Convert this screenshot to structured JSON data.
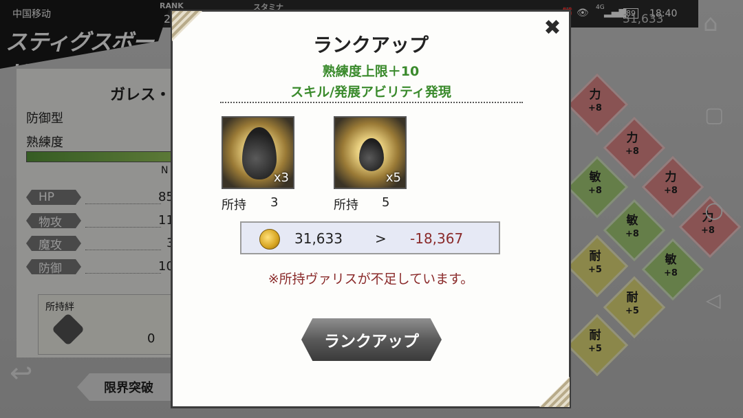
{
  "status_bar": {
    "carrier": "中国移动",
    "network": "4G",
    "battery": "89",
    "time": "18:40"
  },
  "background": {
    "rank_label": "RANK",
    "rank_value": "2",
    "stamina_label": "スタミナ",
    "gold": "31,633",
    "character_name": "ガレス・",
    "type": "防御型",
    "proficiency_label": "熟練度",
    "proficiency_tail": "N",
    "stats": [
      {
        "label": "HP",
        "value": "85",
        "icon": "heart-icon"
      },
      {
        "label": "物攻",
        "value": "11",
        "icon": "sword-icon"
      },
      {
        "label": "魔攻",
        "value": "3",
        "icon": "staff-icon"
      },
      {
        "label": "防御",
        "value": "10",
        "icon": "shield-icon"
      }
    ],
    "bond_label": "所持絆",
    "bond_value": "0",
    "limit_break": "限界突破",
    "board_tiles": [
      {
        "stat": "力",
        "bonus": "+8",
        "color": "#e58a8a"
      },
      {
        "stat": "力",
        "bonus": "+8",
        "color": "#e58a8a"
      },
      {
        "stat": "力",
        "bonus": "+8",
        "color": "#e58a8a"
      },
      {
        "stat": "力",
        "bonus": "+8",
        "color": "#e58a8a"
      },
      {
        "stat": "敏",
        "bonus": "+8",
        "color": "#a9d27a"
      },
      {
        "stat": "敏",
        "bonus": "+8",
        "color": "#a9d27a"
      },
      {
        "stat": "敏",
        "bonus": "+8",
        "color": "#a9d27a"
      },
      {
        "stat": "耐",
        "bonus": "+5",
        "color": "#e8e27c"
      },
      {
        "stat": "耐",
        "bonus": "+5",
        "color": "#e8e27c"
      },
      {
        "stat": "耐",
        "bonus": "+5",
        "color": "#e8e27c"
      }
    ]
  },
  "dialog": {
    "title": "ランクアップ",
    "line1": "熟練度上限＋10",
    "line2": "スキル/発展アビリティ発現",
    "items": [
      {
        "icon": "large-black-drop-icon",
        "qty": "x3",
        "owned_label": "所持",
        "owned": "3"
      },
      {
        "icon": "small-black-drop-icon",
        "qty": "x5",
        "owned_label": "所持",
        "owned": "5"
      }
    ],
    "cost": {
      "current": "31,633",
      "arrow": ">",
      "required": "-18,367"
    },
    "warning": "※所持ヴァリスが不足しています。",
    "button": "ランクアップ",
    "close_symbol": "✖",
    "colors": {
      "green_text": "#3a8a2c",
      "warning_red": "#8a2a2a"
    }
  }
}
